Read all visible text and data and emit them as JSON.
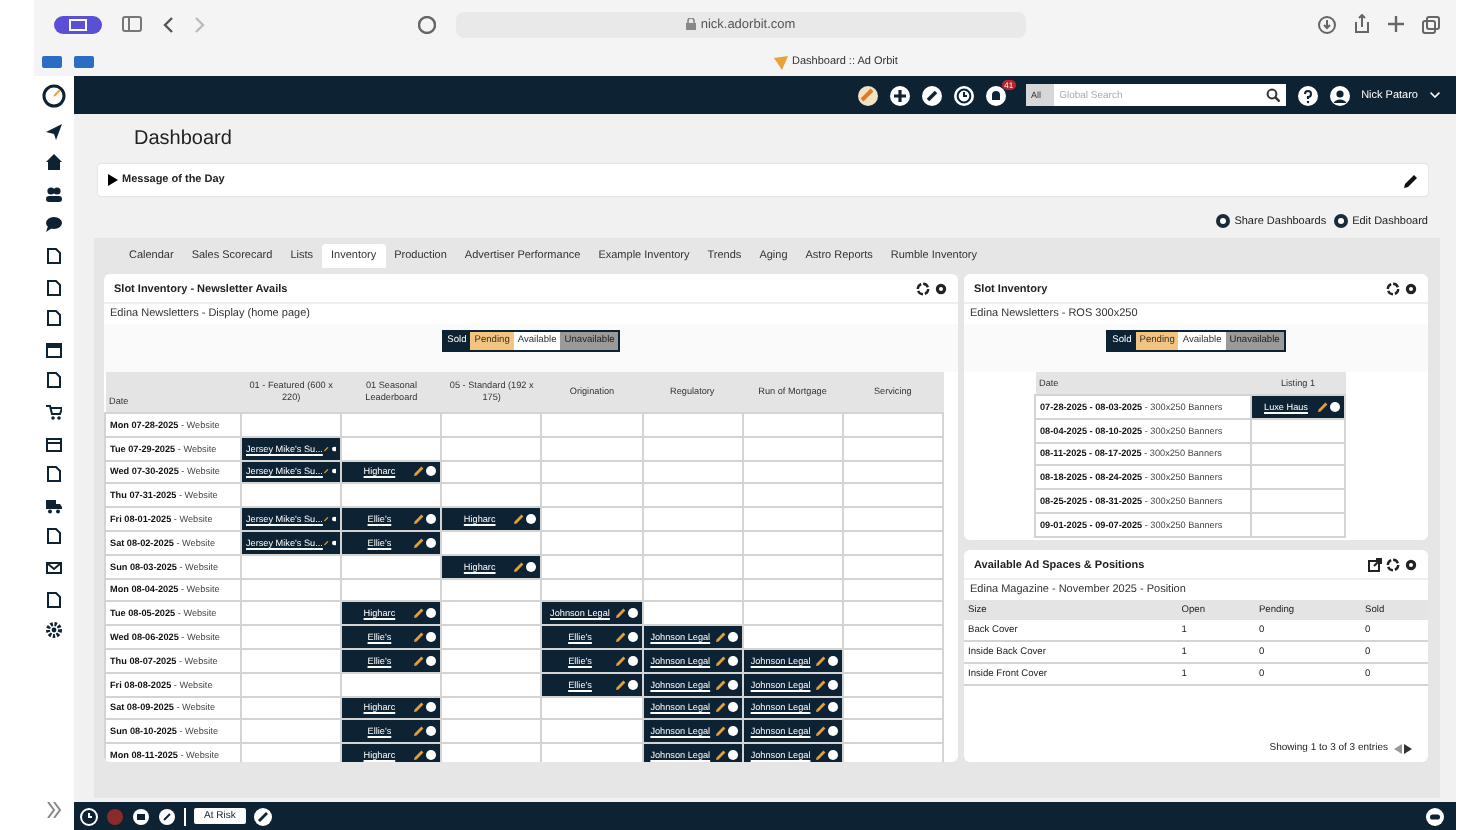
{
  "browser": {
    "url": "nick.adorbit.com",
    "tab_title": "Dashboard :: Ad Orbit"
  },
  "top_bar": {
    "notification_count": "41",
    "search_scope": "All",
    "search": {
      "placeholder": "Global Search"
    },
    "user": "Nick Pataro"
  },
  "page_title": "Dashboard",
  "message_of_the_day": {
    "title": "Message of the Day",
    "expanded": false
  },
  "dashboard_actions": [
    "Share Dashboards",
    "Edit Dashboard"
  ],
  "tabs": [
    {
      "label": "Calendar",
      "selected": false
    },
    {
      "label": "Sales Scorecard",
      "selected": false
    },
    {
      "label": "Lists",
      "selected": false
    },
    {
      "label": "Inventory",
      "selected": true
    },
    {
      "label": "Production",
      "selected": false
    },
    {
      "label": "Advertiser Performance",
      "selected": false
    },
    {
      "label": "Example Inventory",
      "selected": false
    },
    {
      "label": "Trends",
      "selected": false
    },
    {
      "label": "Aging",
      "selected": false
    },
    {
      "label": "Astro Reports",
      "selected": false
    },
    {
      "label": "Rumble Inventory",
      "selected": false
    }
  ],
  "slot_inventory_main": {
    "title": "Slot Inventory - Newsletter Avails",
    "subtitle": "Edina Newsletters - Display (home page)",
    "legend": [
      "Sold",
      "Pending",
      "Available",
      "Unavailable"
    ],
    "columns": [
      "Date",
      "01 - Featured (600 x 220)",
      "01 Seasonal Leaderboard",
      "05 - Standard (192 x 175)",
      "Origination",
      "Regulatory",
      "Run of Mortgage",
      "Servicing"
    ],
    "rows": [
      [
        "**Mon 07-28-2025** - Website",
        "",
        "",
        "",
        "",
        "",
        "",
        ""
      ],
      [
        "**Tue 07-29-2025** - Website",
        "Jersey Mike's Su...",
        "",
        "",
        "",
        "",
        "",
        ""
      ],
      [
        "**Wed 07-30-2025** - Website",
        "Jersey Mike's Su...",
        "Higharc",
        "",
        "",
        "",
        "",
        ""
      ],
      [
        "**Thu 07-31-2025** - Website",
        "",
        "",
        "",
        "",
        "",
        "",
        ""
      ],
      [
        "**Fri 08-01-2025** - Website",
        "Jersey Mike's Su...",
        "Ellie's",
        "Higharc",
        "",
        "",
        "",
        ""
      ],
      [
        "**Sat 08-02-2025** - Website",
        "Jersey Mike's Su...",
        "Ellie's",
        "",
        "",
        "",
        "",
        ""
      ],
      [
        "**Sun 08-03-2025** - Website",
        "",
        "",
        "Higharc",
        "",
        "",
        "",
        ""
      ],
      [
        "**Mon 08-04-2025** - Website",
        "",
        "",
        "",
        "",
        "",
        "",
        ""
      ],
      [
        "**Tue 08-05-2025** - Website",
        "",
        "Higharc",
        "",
        "Johnson Legal",
        "",
        "",
        ""
      ],
      [
        "**Wed 08-06-2025** - Website",
        "",
        "Ellie's",
        "",
        "Ellie's",
        "Johnson Legal",
        "",
        ""
      ],
      [
        "**Thu 08-07-2025** - Website",
        "",
        "Ellie's",
        "",
        "Ellie's",
        "Johnson Legal",
        "Johnson Legal",
        ""
      ],
      [
        "**Fri 08-08-2025** - Website",
        "",
        "",
        "",
        "Ellie's",
        "Johnson Legal",
        "Johnson Legal",
        ""
      ],
      [
        "**Sat 08-09-2025** - Website",
        "",
        "Higharc",
        "",
        "",
        "Johnson Legal",
        "Johnson Legal",
        ""
      ],
      [
        "**Sun 08-10-2025** - Website",
        "",
        "Ellie's",
        "",
        "",
        "Johnson Legal",
        "Johnson Legal",
        ""
      ],
      [
        "**Mon 08-11-2025** - Website",
        "",
        "Higharc",
        "",
        "",
        "Johnson Legal",
        "Johnson Legal",
        ""
      ]
    ]
  },
  "slot_inventory_side": {
    "title": "Slot Inventory",
    "subtitle": "Edina Newsletters - ROS 300x250",
    "legend": [
      "Sold",
      "Pending",
      "Available",
      "Unavailable"
    ],
    "columns": [
      "Date",
      "Listing 1"
    ],
    "rows": [
      [
        "**07-28-2025 - 08-03-2025** - 300x250 Banners",
        "Luxe Haus"
      ],
      [
        "**08-04-2025 - 08-10-2025** - 300x250 Banners",
        ""
      ],
      [
        "**08-11-2025 - 08-17-2025** - 300x250 Banners",
        ""
      ],
      [
        "**08-18-2025 - 08-24-2025** - 300x250 Banners",
        ""
      ],
      [
        "**08-25-2025 - 08-31-2025** - 300x250 Banners",
        ""
      ],
      [
        "**09-01-2025 - 09-07-2025** - 300x250 Banners",
        ""
      ]
    ]
  },
  "ad_spaces": {
    "title": "Available Ad Spaces & Positions",
    "subtitle": "Edina Magazine - November 2025 - Position",
    "columns": [
      "Size",
      "Open",
      "Pending",
      "Sold"
    ],
    "rows": [
      [
        "Back Cover",
        "1",
        "0",
        "0"
      ],
      [
        "Inside Back Cover",
        "1",
        "0",
        "0"
      ],
      [
        "Inside Front Cover",
        "1",
        "0",
        "0"
      ]
    ],
    "footer": "Showing 1 to 3 of 3 entries"
  },
  "bottom_bar": {
    "badge": "At Risk"
  }
}
